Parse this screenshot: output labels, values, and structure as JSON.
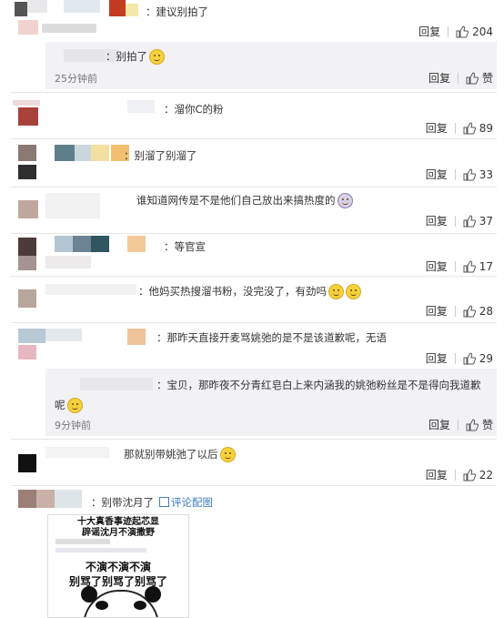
{
  "actions": {
    "reply": "回复",
    "like": "赞"
  },
  "comments": [
    {
      "text": "：建议别拍了",
      "likes": "204"
    },
    {
      "text": "：别拍了",
      "time": "25分钟前"
    },
    {
      "text": "：溜你C的粉",
      "likes": "89"
    },
    {
      "text": "：别溜了别溜了",
      "likes": "33"
    },
    {
      "text": "谁知道网传是不是他们自己放出来搞热度的",
      "likes": "37"
    },
    {
      "text": "：等官宣",
      "likes": "17"
    },
    {
      "text": "：他妈买热搜溜书粉，没完没了，有劲吗",
      "likes": "28"
    },
    {
      "text": "：那昨天直接开麦骂姚弛的是不是该道歉呢，无语",
      "likes": "29"
    },
    {
      "text_line1": "：宝贝，那昨夜不分青红皂白上来内涵我的姚弛粉丝是不是得向我道歉",
      "text_line2": "呢",
      "time": "9分钟前"
    },
    {
      "text": "那就别带姚弛了以后",
      "likes": "22"
    },
    {
      "text": "：别带沈月了",
      "link": "评论配图"
    }
  ],
  "meme": {
    "top_line1": "十大真香事迹起芯显",
    "top_line2": "辟谣沈月不演撒野",
    "line1": "不演不演不演",
    "line2": "别骂了别骂了别骂了"
  },
  "colors": {
    "link": "#3f7bc4",
    "sub_bg": "#f2f2f5"
  }
}
